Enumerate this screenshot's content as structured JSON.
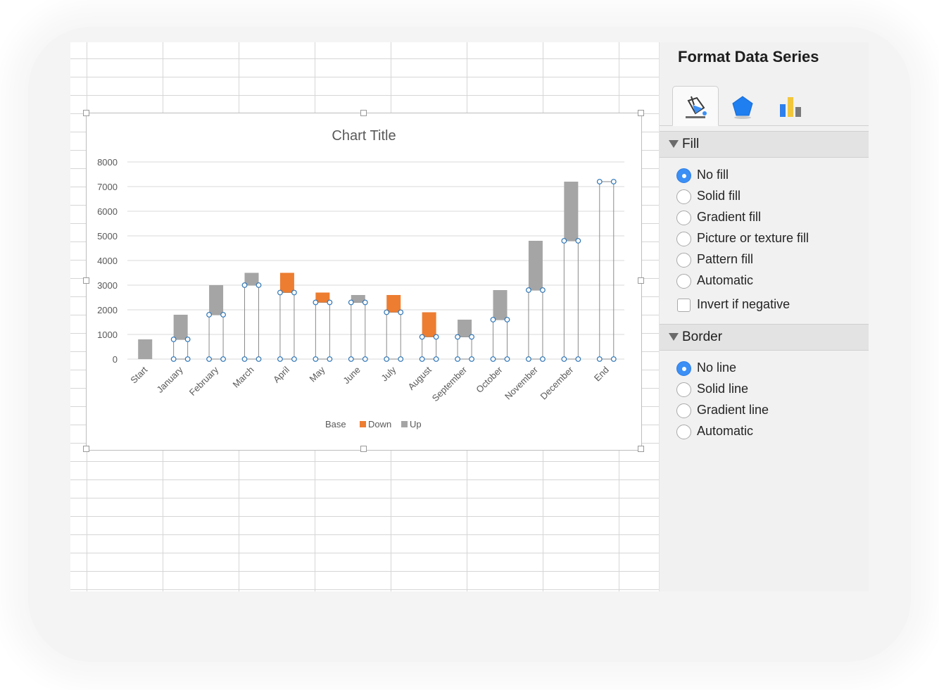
{
  "pane": {
    "title": "Format Data Series",
    "tabs": [
      {
        "icon": "paint-bucket-icon",
        "active": true
      },
      {
        "icon": "pentagon-effects-icon",
        "active": false
      },
      {
        "icon": "bar-chart-options-icon",
        "active": false
      }
    ],
    "fill": {
      "header": "Fill",
      "options": [
        "No fill",
        "Solid fill",
        "Gradient fill",
        "Picture or texture fill",
        "Pattern fill",
        "Automatic"
      ],
      "selected": "No fill",
      "invert_label": "Invert if negative",
      "invert_checked": false
    },
    "border": {
      "header": "Border",
      "options": [
        "No line",
        "Solid line",
        "Gradient line",
        "Automatic"
      ],
      "selected": "No line"
    }
  },
  "colors": {
    "down": "#ed7d31",
    "up": "#a5a5a5",
    "selection": "#2e75b6",
    "radio_on": "#3b8ff5"
  },
  "chart_data": {
    "type": "bar",
    "stacked": true,
    "title": "Chart Title",
    "categories": [
      "Start",
      "January",
      "February",
      "March",
      "April",
      "May",
      "June",
      "July",
      "August",
      "September",
      "October",
      "November",
      "December",
      "End"
    ],
    "series": [
      {
        "name": "Base",
        "values": [
          0,
          800,
          1800,
          3000,
          2700,
          2300,
          2300,
          1900,
          900,
          900,
          1600,
          2800,
          4800,
          7200
        ],
        "fill": "none",
        "selected": true
      },
      {
        "name": "Down",
        "values": [
          0,
          0,
          0,
          0,
          800,
          400,
          0,
          700,
          1000,
          0,
          0,
          0,
          0,
          0
        ]
      },
      {
        "name": "Up",
        "values": [
          800,
          1000,
          1200,
          500,
          0,
          0,
          300,
          0,
          0,
          700,
          1200,
          2000,
          2400,
          0
        ]
      }
    ],
    "ylim": [
      0,
      8000
    ],
    "yticks": [
      0,
      1000,
      2000,
      3000,
      4000,
      5000,
      6000,
      7000,
      8000
    ],
    "grid": true,
    "legend": "bottom",
    "xlabel": "",
    "ylabel": ""
  }
}
